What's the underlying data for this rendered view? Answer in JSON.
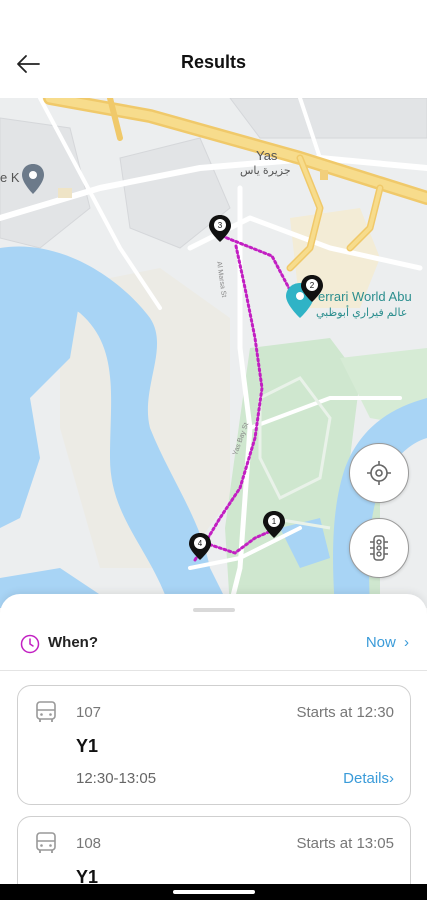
{
  "header": {
    "title": "Results",
    "back_icon": "arrow-left-icon"
  },
  "map": {
    "labels": {
      "yas": "Yas",
      "yas_arabic": "جزيرة ياس",
      "left_place": "e K",
      "ferrari": "errari World Abu",
      "ferrari_arabic": "عالم فيراري أبوظبي",
      "road": "Al Marsa St",
      "road_lower": "Yas Bay St"
    },
    "stops": [
      "3",
      "2",
      "1",
      "4"
    ],
    "route_color": "#c21fc2",
    "locate_icon": "crosshair-icon",
    "traffic_icon": "traffic-light-icon"
  },
  "when": {
    "label": "When?",
    "value": "Now",
    "icon": "clock-icon",
    "accent": "#3a9bd9"
  },
  "trips": [
    {
      "number": "107",
      "starts": "Starts at 12:30",
      "route": "Y1",
      "time": "12:30-13:05",
      "details": "Details"
    },
    {
      "number": "108",
      "starts": "Starts at 13:05",
      "route": "Y1",
      "time": "",
      "details": ""
    }
  ]
}
